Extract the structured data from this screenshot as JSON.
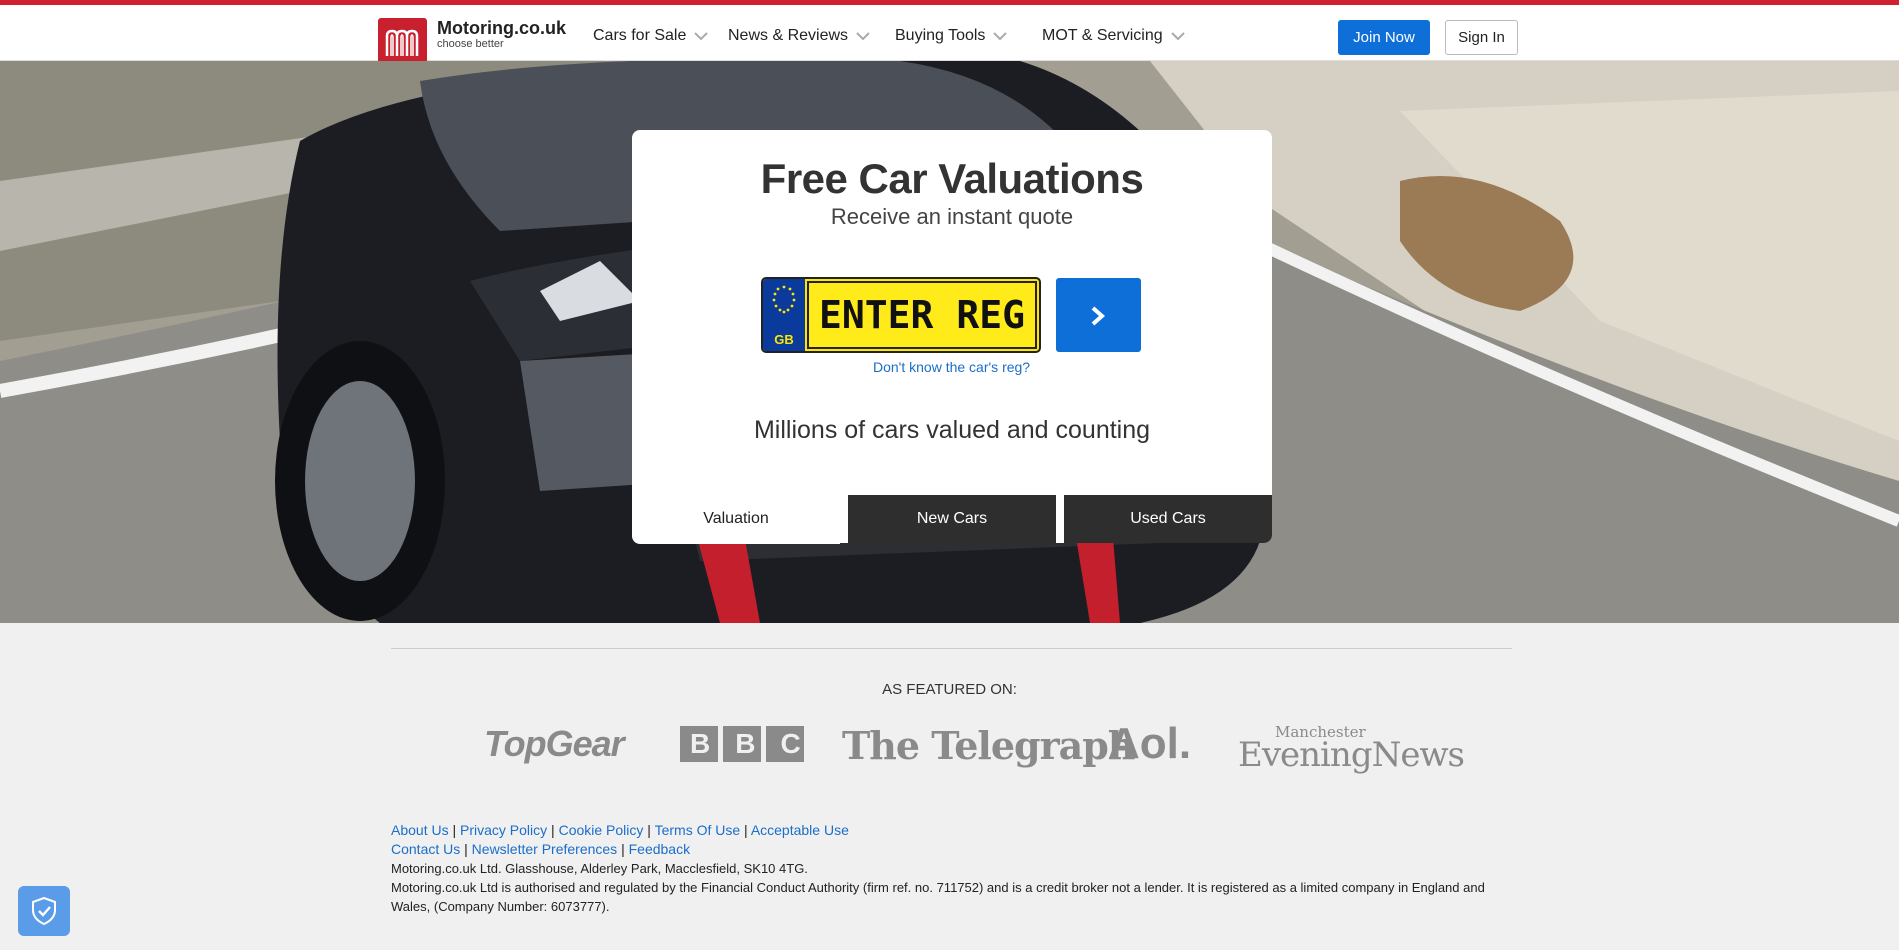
{
  "header": {
    "brand_name": "Motoring.co.uk",
    "brand_tagline": "choose better",
    "nav": [
      {
        "label": "Cars for Sale"
      },
      {
        "label": "News & Reviews"
      },
      {
        "label": "Buying Tools"
      },
      {
        "label": "MOT & Servicing"
      }
    ],
    "join_label": "Join Now",
    "signin_label": "Sign In",
    "accent_color": "#d1202f"
  },
  "hero": {
    "title": "Free Car Valuations",
    "subtitle": "Receive an instant quote",
    "plate_country": "GB",
    "plate_placeholder": "ENTER REG",
    "dont_know_link": "Don't know the car's reg?",
    "tagline": "Millions of cars valued and counting",
    "tabs": [
      {
        "label": "Valuation",
        "active": true
      },
      {
        "label": "New Cars",
        "active": false
      },
      {
        "label": "Used Cars",
        "active": false
      }
    ]
  },
  "featured": {
    "label": "AS FEATURED ON:",
    "logos": [
      "TopGear",
      "BBC",
      "The Telegraph",
      "Aol.",
      "Manchester",
      "EveningNews"
    ]
  },
  "footer": {
    "links_row1": [
      "About Us",
      "Privacy Policy",
      "Cookie Policy",
      "Terms Of Use",
      "Acceptable Use"
    ],
    "links_row2": [
      "Contact Us",
      "Newsletter Preferences",
      "Feedback"
    ],
    "address": "Motoring.co.uk Ltd. Glasshouse, Alderley Park, Macclesfield, SK10 4TG.",
    "legal": "Motoring.co.uk Ltd is authorised and regulated by the Financial Conduct Authority (firm ref. no. 711752) and is a credit broker not a lender. It is registered as a limited company in England and Wales, (Company Number: 6073777)."
  },
  "icons": {
    "logo": "motoring-logo-icon",
    "chevron": "chevron-down-icon",
    "arrow": "chevron-right-icon",
    "shield": "shield-check-icon"
  }
}
